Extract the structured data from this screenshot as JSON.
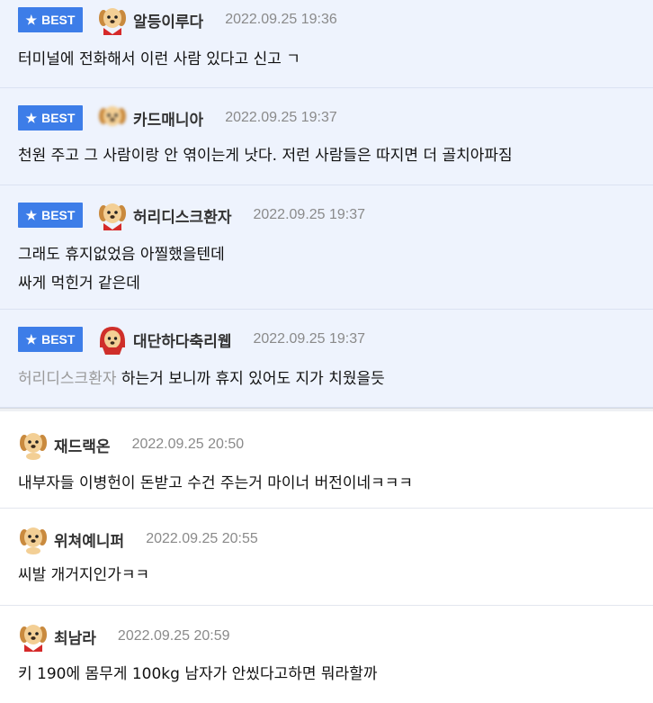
{
  "best_label": "BEST",
  "comments": [
    {
      "nick": "알등이루다",
      "date": "2022.09.25 19:36",
      "avatar": "dog-red-scarf-icon",
      "lines": [
        "터미널에 전화해서 이런 사람 있다고 신고 ㄱ"
      ]
    },
    {
      "nick": "카드매니아",
      "date": "2022.09.25 19:37",
      "avatar": "dog-blurred-icon",
      "lines": [
        "천원 주고 그 사람이랑 안 엮이는게 낫다. 저런 사람들은 따지면 더 골치아파짐"
      ]
    },
    {
      "nick": "허리디스크환자",
      "date": "2022.09.25 19:37",
      "avatar": "dog-red-scarf-icon",
      "lines": [
        "그래도 휴지없었음 아찔했을텐데",
        "싸게 먹힌거 같은데"
      ]
    },
    {
      "nick": "대단하다축리웹",
      "date": "2022.09.25 19:37",
      "avatar": "dog-red-hood-icon",
      "mention": "허리디스크환자",
      "lines": [
        " 하는거 보니까 휴지 있어도 지가 치웠을듯"
      ]
    },
    {
      "nick": "재드랙온",
      "date": "2022.09.25 20:50",
      "avatar": "dog-plain-icon",
      "lines": [
        "내부자들 이병헌이 돈받고 수건 주는거 마이너 버전이네ㅋㅋㅋ"
      ]
    },
    {
      "nick": "위쳐예니퍼",
      "date": "2022.09.25 20:55",
      "avatar": "dog-plain-icon",
      "lines": [
        "씨발 개거지인가ㅋㅋ"
      ]
    },
    {
      "nick": "최남라",
      "date": "2022.09.25 20:59",
      "avatar": "dog-red-scarf-icon",
      "lines": [
        "키 190에 몸무게 100kg 남자가 안씼다고하면 뭐라할까"
      ]
    }
  ]
}
